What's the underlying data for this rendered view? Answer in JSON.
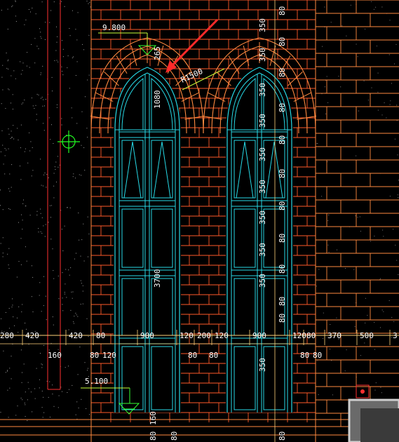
{
  "colors": {
    "background": "#000000",
    "brick": "#ff5a2a",
    "brick_light": "#ff8a40",
    "glass": "#27d9e6",
    "dimension": "#ffffff",
    "leader": "#c8ff3a",
    "level_marker": "#33ff33",
    "arrow": "#ff2a2a",
    "crosshair": "#22ff22",
    "column": "#ff3030",
    "cursor_box": "#c8c8c8"
  },
  "annotations": {
    "level_top": "9.800",
    "level_bottom": "5.100",
    "arch_height": "265",
    "radius": "R1500",
    "window_top_height": "1080",
    "window_height": "3700"
  },
  "horizontal_dims": [
    "280",
    "420",
    "420",
    "80",
    "900",
    "120",
    "200",
    "120",
    "900",
    "120",
    "80",
    "370",
    "500",
    "3"
  ],
  "horizontal_dims_lower": [
    "160",
    "80",
    "120",
    "80",
    "80",
    "80",
    "80"
  ],
  "vertical_dims_right": [
    "80",
    "350",
    "80",
    "350",
    "80",
    "350",
    "80",
    "350",
    "80",
    "350",
    "80",
    "350",
    "80",
    "350",
    "80",
    "350",
    "80",
    "350",
    "80",
    "80",
    "350"
  ],
  "vertical_dims_bottom": [
    "80",
    "160",
    "80",
    "80"
  ],
  "icons": {
    "crosshair": "crosshair-icon",
    "arrow": "red-arrow-pointer",
    "level_symbol": "level-triangle-icon"
  }
}
